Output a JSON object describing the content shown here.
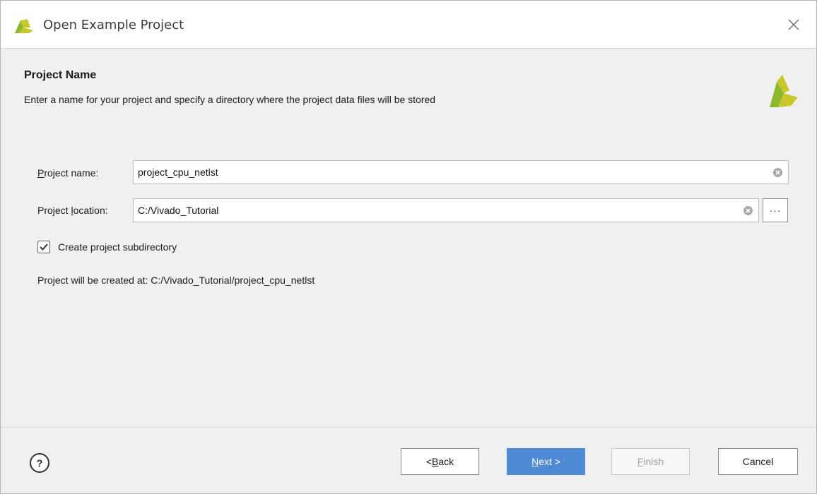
{
  "window": {
    "title": "Open Example Project"
  },
  "header": {
    "title": "Project Name",
    "description": "Enter a name for your project and specify a directory where the project data files will be stored"
  },
  "form": {
    "project_name": {
      "label_mnemonic": "P",
      "label_rest": "roject name:",
      "value": "project_cpu_netlst"
    },
    "project_location": {
      "label_prefix": "Project ",
      "label_mnemonic": "l",
      "label_rest": "ocation:",
      "value": "C:/Vivado_Tutorial",
      "browse_label": "···"
    },
    "create_subdirectory": {
      "label": "Create project subdirectory",
      "checked": true
    },
    "result_text": "Project will be created at: C:/Vivado_Tutorial/project_cpu_netlst"
  },
  "footer": {
    "help_label": "?",
    "back": {
      "prefix": "< ",
      "mnemonic": "B",
      "rest": "ack"
    },
    "next": {
      "mnemonic": "N",
      "rest": "ext >"
    },
    "finish": {
      "mnemonic": "F",
      "rest": "inish"
    },
    "cancel": {
      "label": "Cancel"
    }
  },
  "colors": {
    "logo_yellow": "#c9c72a",
    "logo_green": "#8bb82d",
    "primary_button": "#4e8ad6"
  },
  "icons": {
    "app_logo": "vivado-logo-icon",
    "close": "close-icon",
    "clear": "clear-input-icon",
    "check": "checkmark-icon",
    "help": "help-icon"
  }
}
